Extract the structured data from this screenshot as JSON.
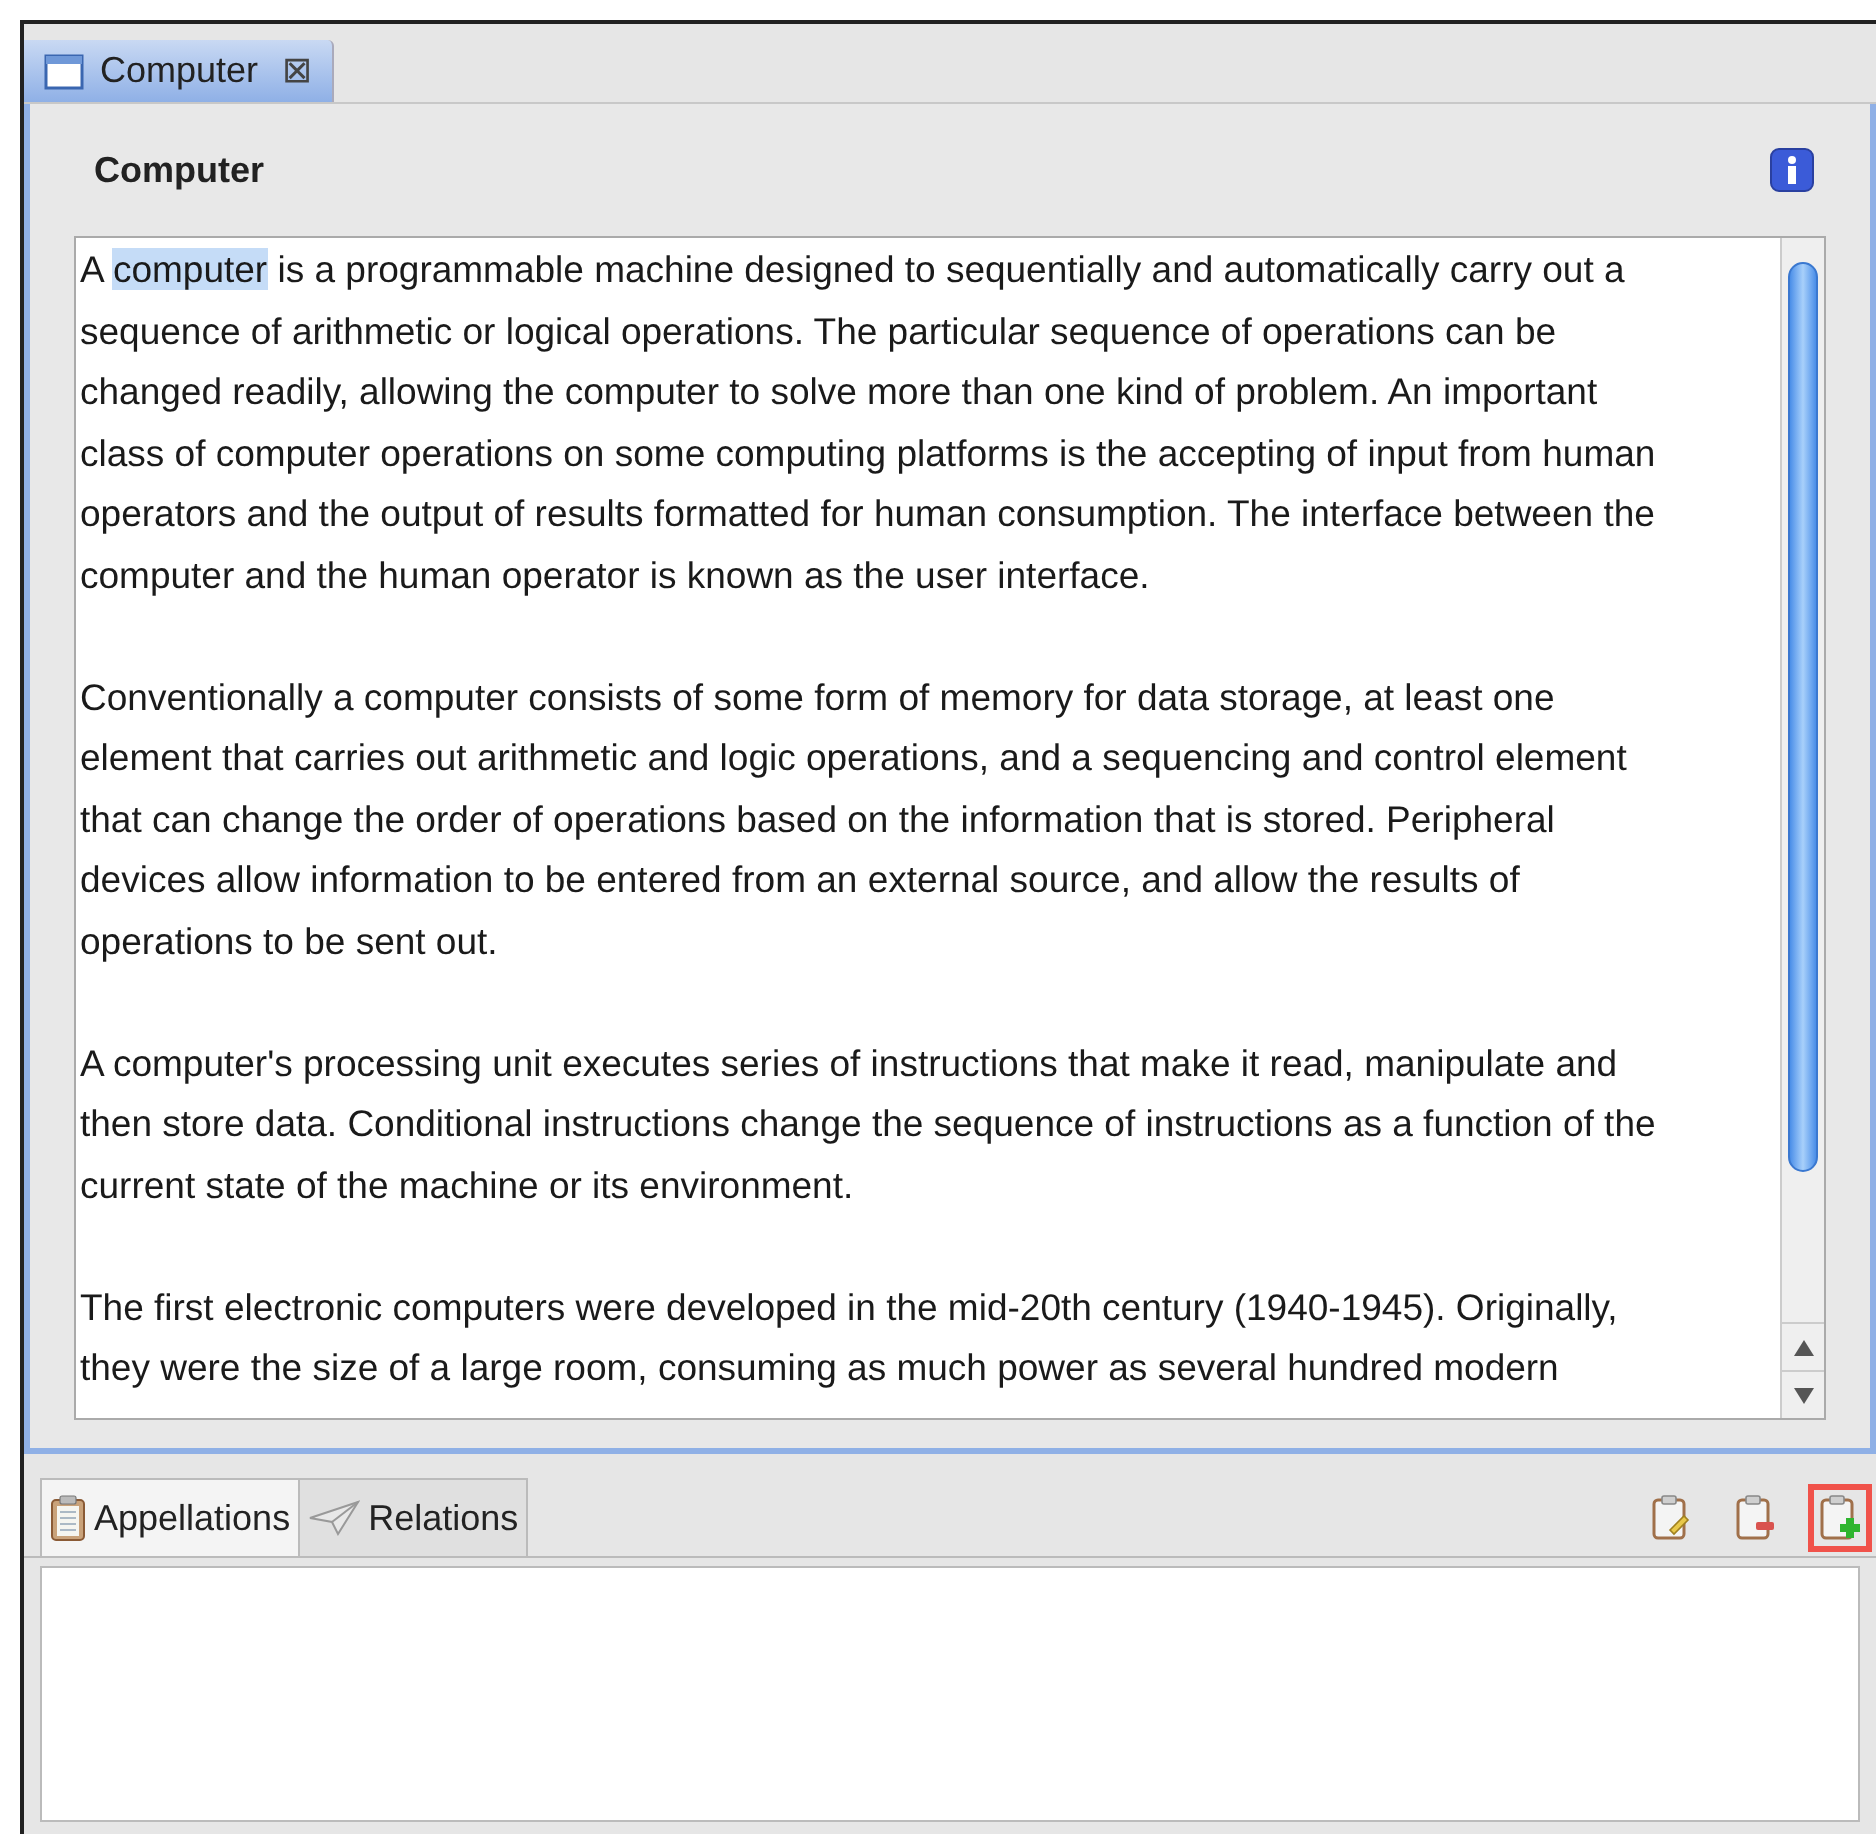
{
  "editor_tab": {
    "title": "Computer",
    "close": "⊠",
    "selected": true
  },
  "heading": "Computer",
  "paragraphs": [
    {
      "lines": [
        [
          {
            "text": "A ",
            "selected": false
          },
          {
            "text": "computer",
            "selected": true
          },
          {
            "text": " is a programmable machine designed to sequentially and automatically carry out a",
            "selected": false
          }
        ],
        "sequence of arithmetic or logical operations. The particular sequence of operations can be",
        "changed readily, allowing the computer to solve more than one kind of problem. An important",
        "class of computer operations on some computing platforms is the accepting of input from human",
        "operators and the output of results formatted for human consumption. The interface between the",
        "computer and the human operator is known as the user interface."
      ]
    },
    {
      "lines": [
        "Conventionally a computer consists of some form of memory for data storage, at least one",
        "element that carries out arithmetic and logic operations, and a sequencing and control element",
        "that can change the order of operations based on the information that is stored. Peripheral",
        "devices allow information to be entered from an external source, and allow the results of",
        "operations to be sent out."
      ]
    },
    {
      "lines": [
        "A computer's processing unit executes series of instructions that make it read, manipulate and",
        "then store data. Conditional instructions change the sequence of instructions as a function of the",
        "current state of the machine or its environment."
      ]
    },
    {
      "lines": [
        "The first electronic computers were developed in the mid-20th century (1940-1945). Originally,",
        "they were the size of a large room, consuming as much power as several hundred modern"
      ]
    }
  ],
  "bottom_tabs": [
    {
      "label": "Appellations",
      "kind": "clipboard",
      "selected": true
    },
    {
      "label": "Relations",
      "kind": "plane",
      "selected": false
    }
  ],
  "toolbar": [
    {
      "kind": "edit",
      "highlighted": false
    },
    {
      "kind": "remove",
      "highlighted": false
    },
    {
      "kind": "add",
      "highlighted": true
    }
  ]
}
